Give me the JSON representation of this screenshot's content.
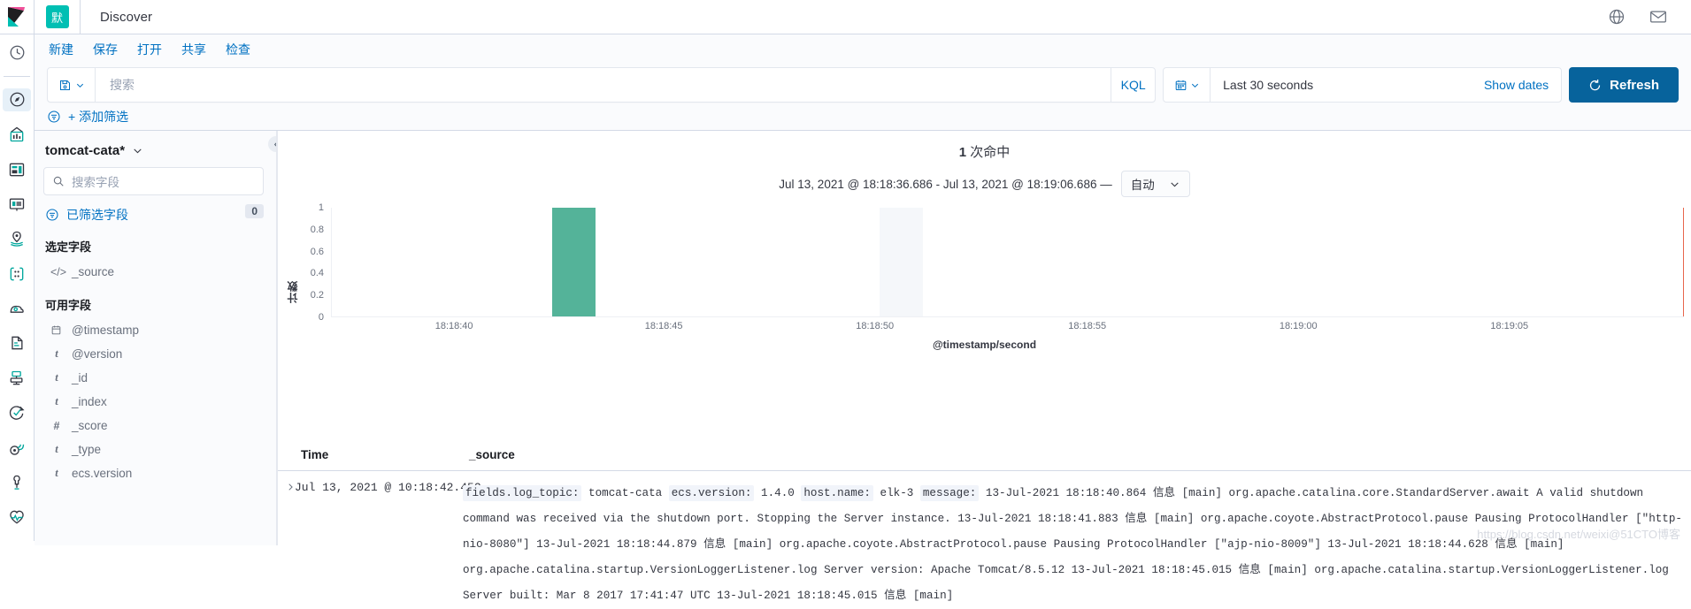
{
  "header": {
    "app_title": "Discover",
    "space_badge": "默",
    "icons": [
      "globe-icon",
      "mail-icon"
    ]
  },
  "rail": {
    "items": [
      {
        "name": "recently-viewed",
        "icon": "clock-icon"
      },
      {
        "name": "discover",
        "icon": "compass-icon",
        "active": true
      },
      {
        "name": "visualize",
        "icon": "bar-chart-icon"
      },
      {
        "name": "dashboard",
        "icon": "dashboard-icon"
      },
      {
        "name": "canvas",
        "icon": "canvas-icon"
      },
      {
        "name": "maps",
        "icon": "map-pin-icon"
      },
      {
        "name": "machine-learning",
        "icon": "machine-learning-icon"
      },
      {
        "name": "infrastructure",
        "icon": "infrastructure-icon"
      },
      {
        "name": "logs",
        "icon": "logs-icon"
      },
      {
        "name": "apm",
        "icon": "apm-icon"
      },
      {
        "name": "uptime",
        "icon": "uptime-icon"
      },
      {
        "name": "siem",
        "icon": "siem-icon"
      },
      {
        "name": "dev-tools",
        "icon": "wrench-icon"
      },
      {
        "name": "monitoring",
        "icon": "heartbeat-icon"
      }
    ]
  },
  "menu": {
    "items": [
      {
        "label": "新建",
        "name": "menu-new"
      },
      {
        "label": "保存",
        "name": "menu-save"
      },
      {
        "label": "打开",
        "name": "menu-open"
      },
      {
        "label": "共享",
        "name": "menu-share"
      },
      {
        "label": "检查",
        "name": "menu-inspect"
      }
    ]
  },
  "query_bar": {
    "search_placeholder": "搜索",
    "search_value": "",
    "language": "KQL",
    "date_range": "Last 30 seconds",
    "show_dates_label": "Show dates",
    "refresh_label": "Refresh"
  },
  "filter_bar": {
    "add_filter_label": "+ 添加筛选"
  },
  "sidebar": {
    "index_pattern": "tomcat-cata*",
    "field_search_placeholder": "搜索字段",
    "filtered_fields_label": "已筛选字段",
    "filtered_fields_count": "0",
    "selected_fields_title": "选定字段",
    "selected_fields": [
      {
        "name": "_source",
        "type": "source"
      }
    ],
    "available_fields_title": "可用字段",
    "available_fields": [
      {
        "name": "@timestamp",
        "type": "date"
      },
      {
        "name": "@version",
        "type": "t"
      },
      {
        "name": "_id",
        "type": "t"
      },
      {
        "name": "_index",
        "type": "t"
      },
      {
        "name": "_score",
        "type": "number"
      },
      {
        "name": "_type",
        "type": "t"
      },
      {
        "name": "ecs.version",
        "type": "t"
      }
    ]
  },
  "discover": {
    "hits_count": "1",
    "hits_label": "次命中",
    "time_range_text": "Jul 13, 2021 @ 18:18:36.686 - Jul 13, 2021 @ 18:19:06.686 —",
    "interval_value": "自动"
  },
  "chart_data": {
    "type": "bar",
    "title": "",
    "xlabel": "@timestamp/second",
    "ylabel": "计数",
    "ylim": [
      0,
      1
    ],
    "yticks": [
      "0",
      "0.2",
      "0.4",
      "0.6",
      "0.8",
      "1"
    ],
    "ytick_values": [
      0,
      0.2,
      0.4,
      0.6,
      0.8,
      1
    ],
    "xticks": [
      "18:18:40",
      "18:18:45",
      "18:18:50",
      "18:18:55",
      "18:19:00",
      "18:19:05"
    ],
    "x_range": [
      "18:18:36.686",
      "18:19:06.686"
    ],
    "categories": [
      "18:18:42"
    ],
    "values": [
      1
    ],
    "bar_color": "#54b399",
    "hover_band_color": "#f5f7fa",
    "end_marker_color": "#e7664c",
    "grid": false,
    "legend": "none"
  },
  "doc_table": {
    "columns": [
      "Time",
      "_source"
    ],
    "rows": [
      {
        "time": "Jul 13, 2021 @ 10:18:42.452",
        "fields": [
          {
            "key": "fields.log_topic:",
            "value": "tomcat-cata"
          },
          {
            "key": "ecs.version:",
            "value": "1.4.0"
          },
          {
            "key": "host.name:",
            "value": "elk-3"
          },
          {
            "key": "message:",
            "value": "13-Jul-2021 18:18:40.864 信息 [main] org.apache.catalina.core.StandardServer.await A valid shutdown command was received via the shutdown port. Stopping the Server instance. 13-Jul-2021 18:18:41.883 信息 [main] org.apache.coyote.AbstractProtocol.pause Pausing ProtocolHandler [\"http-nio-8080\"] 13-Jul-2021 18:18:44.879 信息 [main] org.apache.coyote.AbstractProtocol.pause Pausing ProtocolHandler [\"ajp-nio-8009\"] 13-Jul-2021 18:18:44.628 信息 [main] org.apache.catalina.startup.VersionLoggerListener.log Server version: Apache Tomcat/8.5.12 13-Jul-2021 18:18:45.015 信息 [main] org.apache.catalina.startup.VersionLoggerListener.log Server built: Mar 8 2017 17:41:47 UTC 13-Jul-2021 18:18:45.015 信息 [main]"
          }
        ]
      }
    ]
  },
  "watermark": "https://blog.csdn.net/weixi@51CTO博客"
}
